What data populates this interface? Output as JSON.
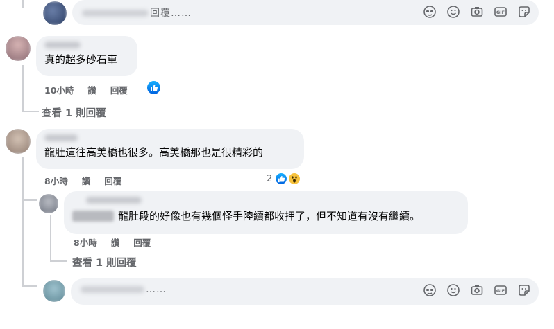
{
  "top_composer": {
    "placeholder": "回覆……",
    "icons": [
      "sticker-face-icon",
      "emoji-icon",
      "camera-icon",
      "gif-icon",
      "sticker-icon"
    ]
  },
  "comments": [
    {
      "text": "真的超多砂石車",
      "time": "10小時",
      "like_label": "讚",
      "reply_label": "回覆",
      "view_replies": "查看 1 則回覆"
    },
    {
      "text": "龍肚這往高美橋也很多。高美橋那也是很精彩的",
      "time": "8小時",
      "like_label": "讚",
      "reply_label": "回覆",
      "reaction_count": "2"
    }
  ],
  "reply": {
    "text": "龍肚段的好像也有幾個怪手陸續都收押了，但不知道有沒有繼續。",
    "time": "8小時",
    "like_label": "讚",
    "reply_label": "回覆",
    "view_replies": "查看 1 則回覆"
  },
  "bottom_composer": {
    "placeholder": "……"
  }
}
